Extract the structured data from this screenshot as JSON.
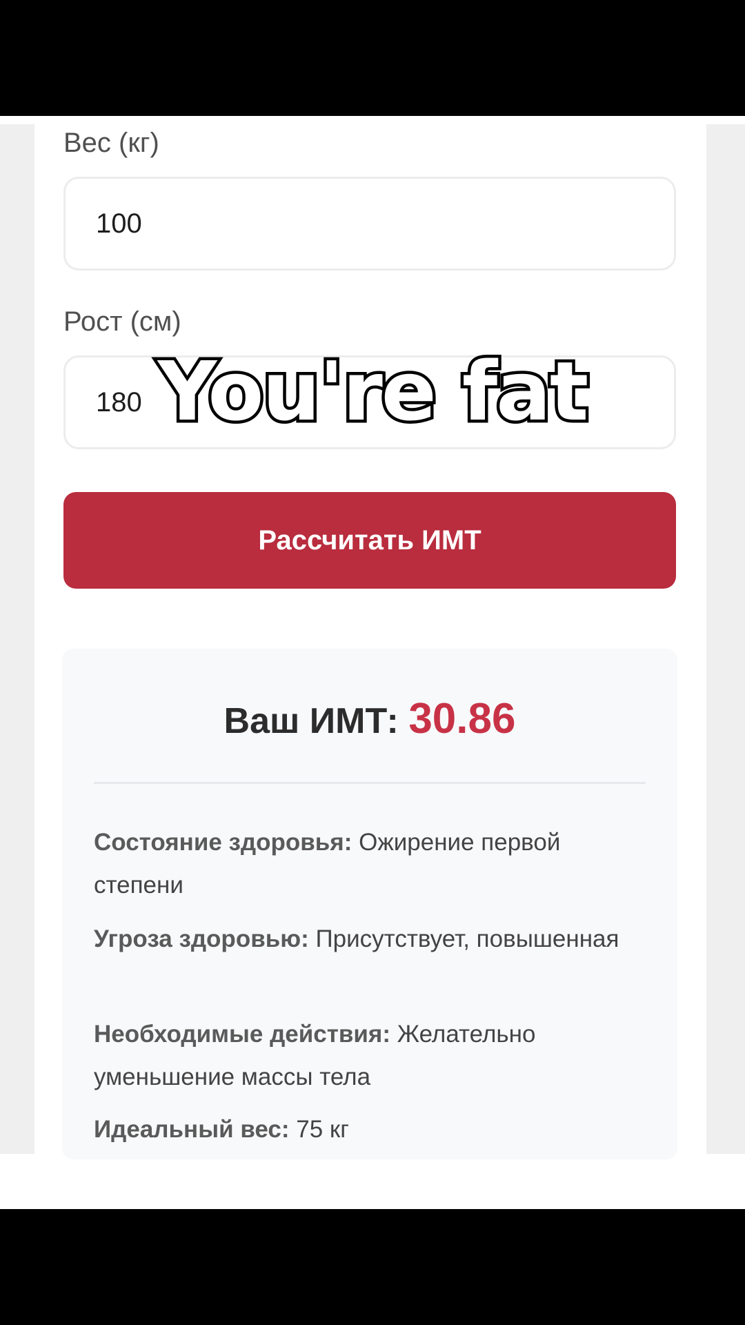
{
  "form": {
    "weight_label": "Вес (кг)",
    "weight_value": "100",
    "height_label": "Рост (см)",
    "height_value": "180",
    "calculate_label": "Рассчитать ИМТ"
  },
  "result": {
    "title_prefix": "Ваш ИМТ: ",
    "bmi_value": "30.86",
    "rows": [
      {
        "key": "Состояние здоровья:",
        "value": " Ожирение первой степени"
      },
      {
        "key": "Угроза здоровью:",
        "value": " Присутствует, повышенная"
      },
      {
        "key": "Необходимые действия:",
        "value": " Желательно уменьшение массы тела"
      },
      {
        "key": "Идеальный вес:",
        "value": " 75 кг"
      }
    ]
  },
  "overlay": {
    "caption": "You're fat"
  },
  "colors": {
    "accent": "#b92d3e",
    "bmi_value": "#c83246",
    "card_background": "#f8f9fb"
  }
}
